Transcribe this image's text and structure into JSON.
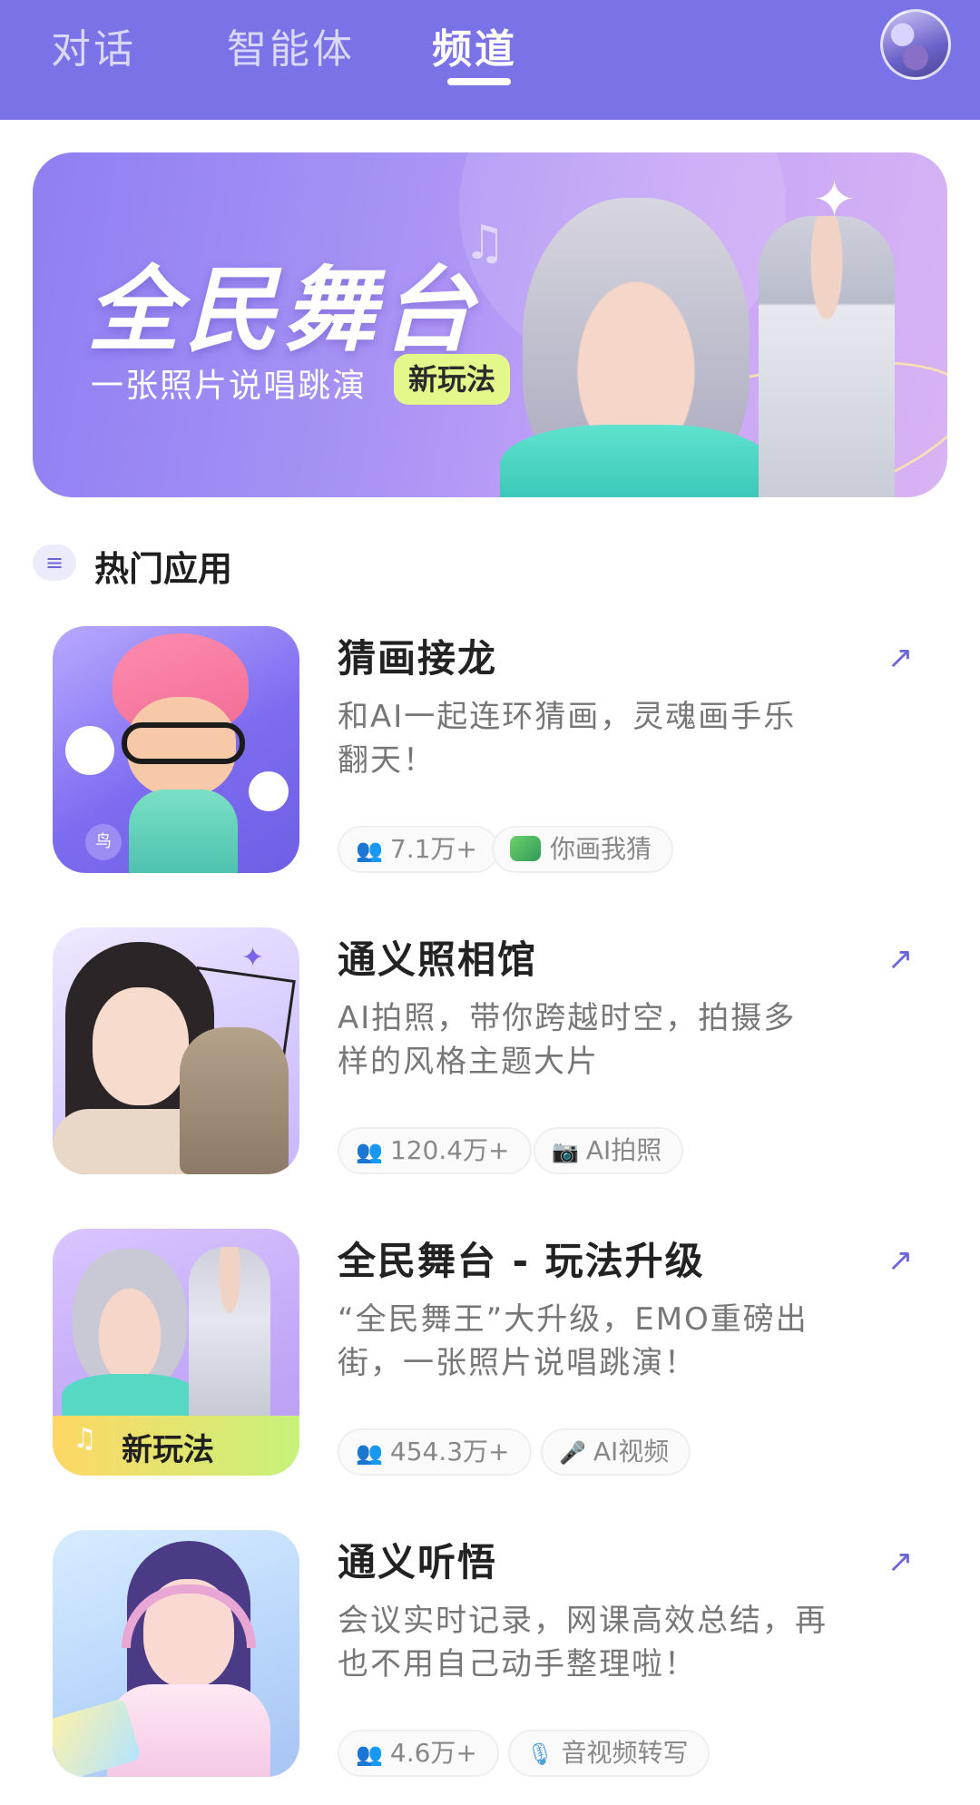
{
  "header": {
    "tabs": [
      {
        "label": "对话"
      },
      {
        "label": "智能体"
      },
      {
        "label": "频道"
      }
    ],
    "active_tab": "频道",
    "avatar_icon": "user-avatar-icon"
  },
  "banner": {
    "title": "全民舞台",
    "subtitle": "一张照片说唱跳演",
    "badge": "新玩法"
  },
  "section": {
    "title": "热门应用",
    "icon": "list-icon"
  },
  "apps": [
    {
      "title": "猜画接龙",
      "description": "和AI一起连环猜画，灵魂画手乐翻天！",
      "users": "7.1万+",
      "tag": "你画我猜",
      "tag_icon": "dragon-icon",
      "thumb_tag": "鸟"
    },
    {
      "title": "通义照相馆",
      "description": "AI拍照，带你跨越时空，拍摄多样的风格主题大片",
      "users": "120.4万+",
      "tag": "AI拍照",
      "tag_icon": "camera-icon"
    },
    {
      "title": "全民舞台 - 玩法升级",
      "description": "“全民舞王”大升级，EMO重磅出街，一张照片说唱跳演！",
      "users": "454.3万+",
      "tag": "AI视频",
      "tag_icon": "microphone-icon",
      "thumb_badge": "新玩法"
    },
    {
      "title": "通义听悟",
      "description": "会议实时记录，网课高效总结，再也不用自己动手整理啦！",
      "users": "4.6万+",
      "tag": "音视频转写",
      "tag_icon": "microphone-icon"
    }
  ],
  "colors": {
    "header_bg": "#7a73e8",
    "accent": "#6d66d8",
    "badge_bg": "#e4f78a"
  }
}
